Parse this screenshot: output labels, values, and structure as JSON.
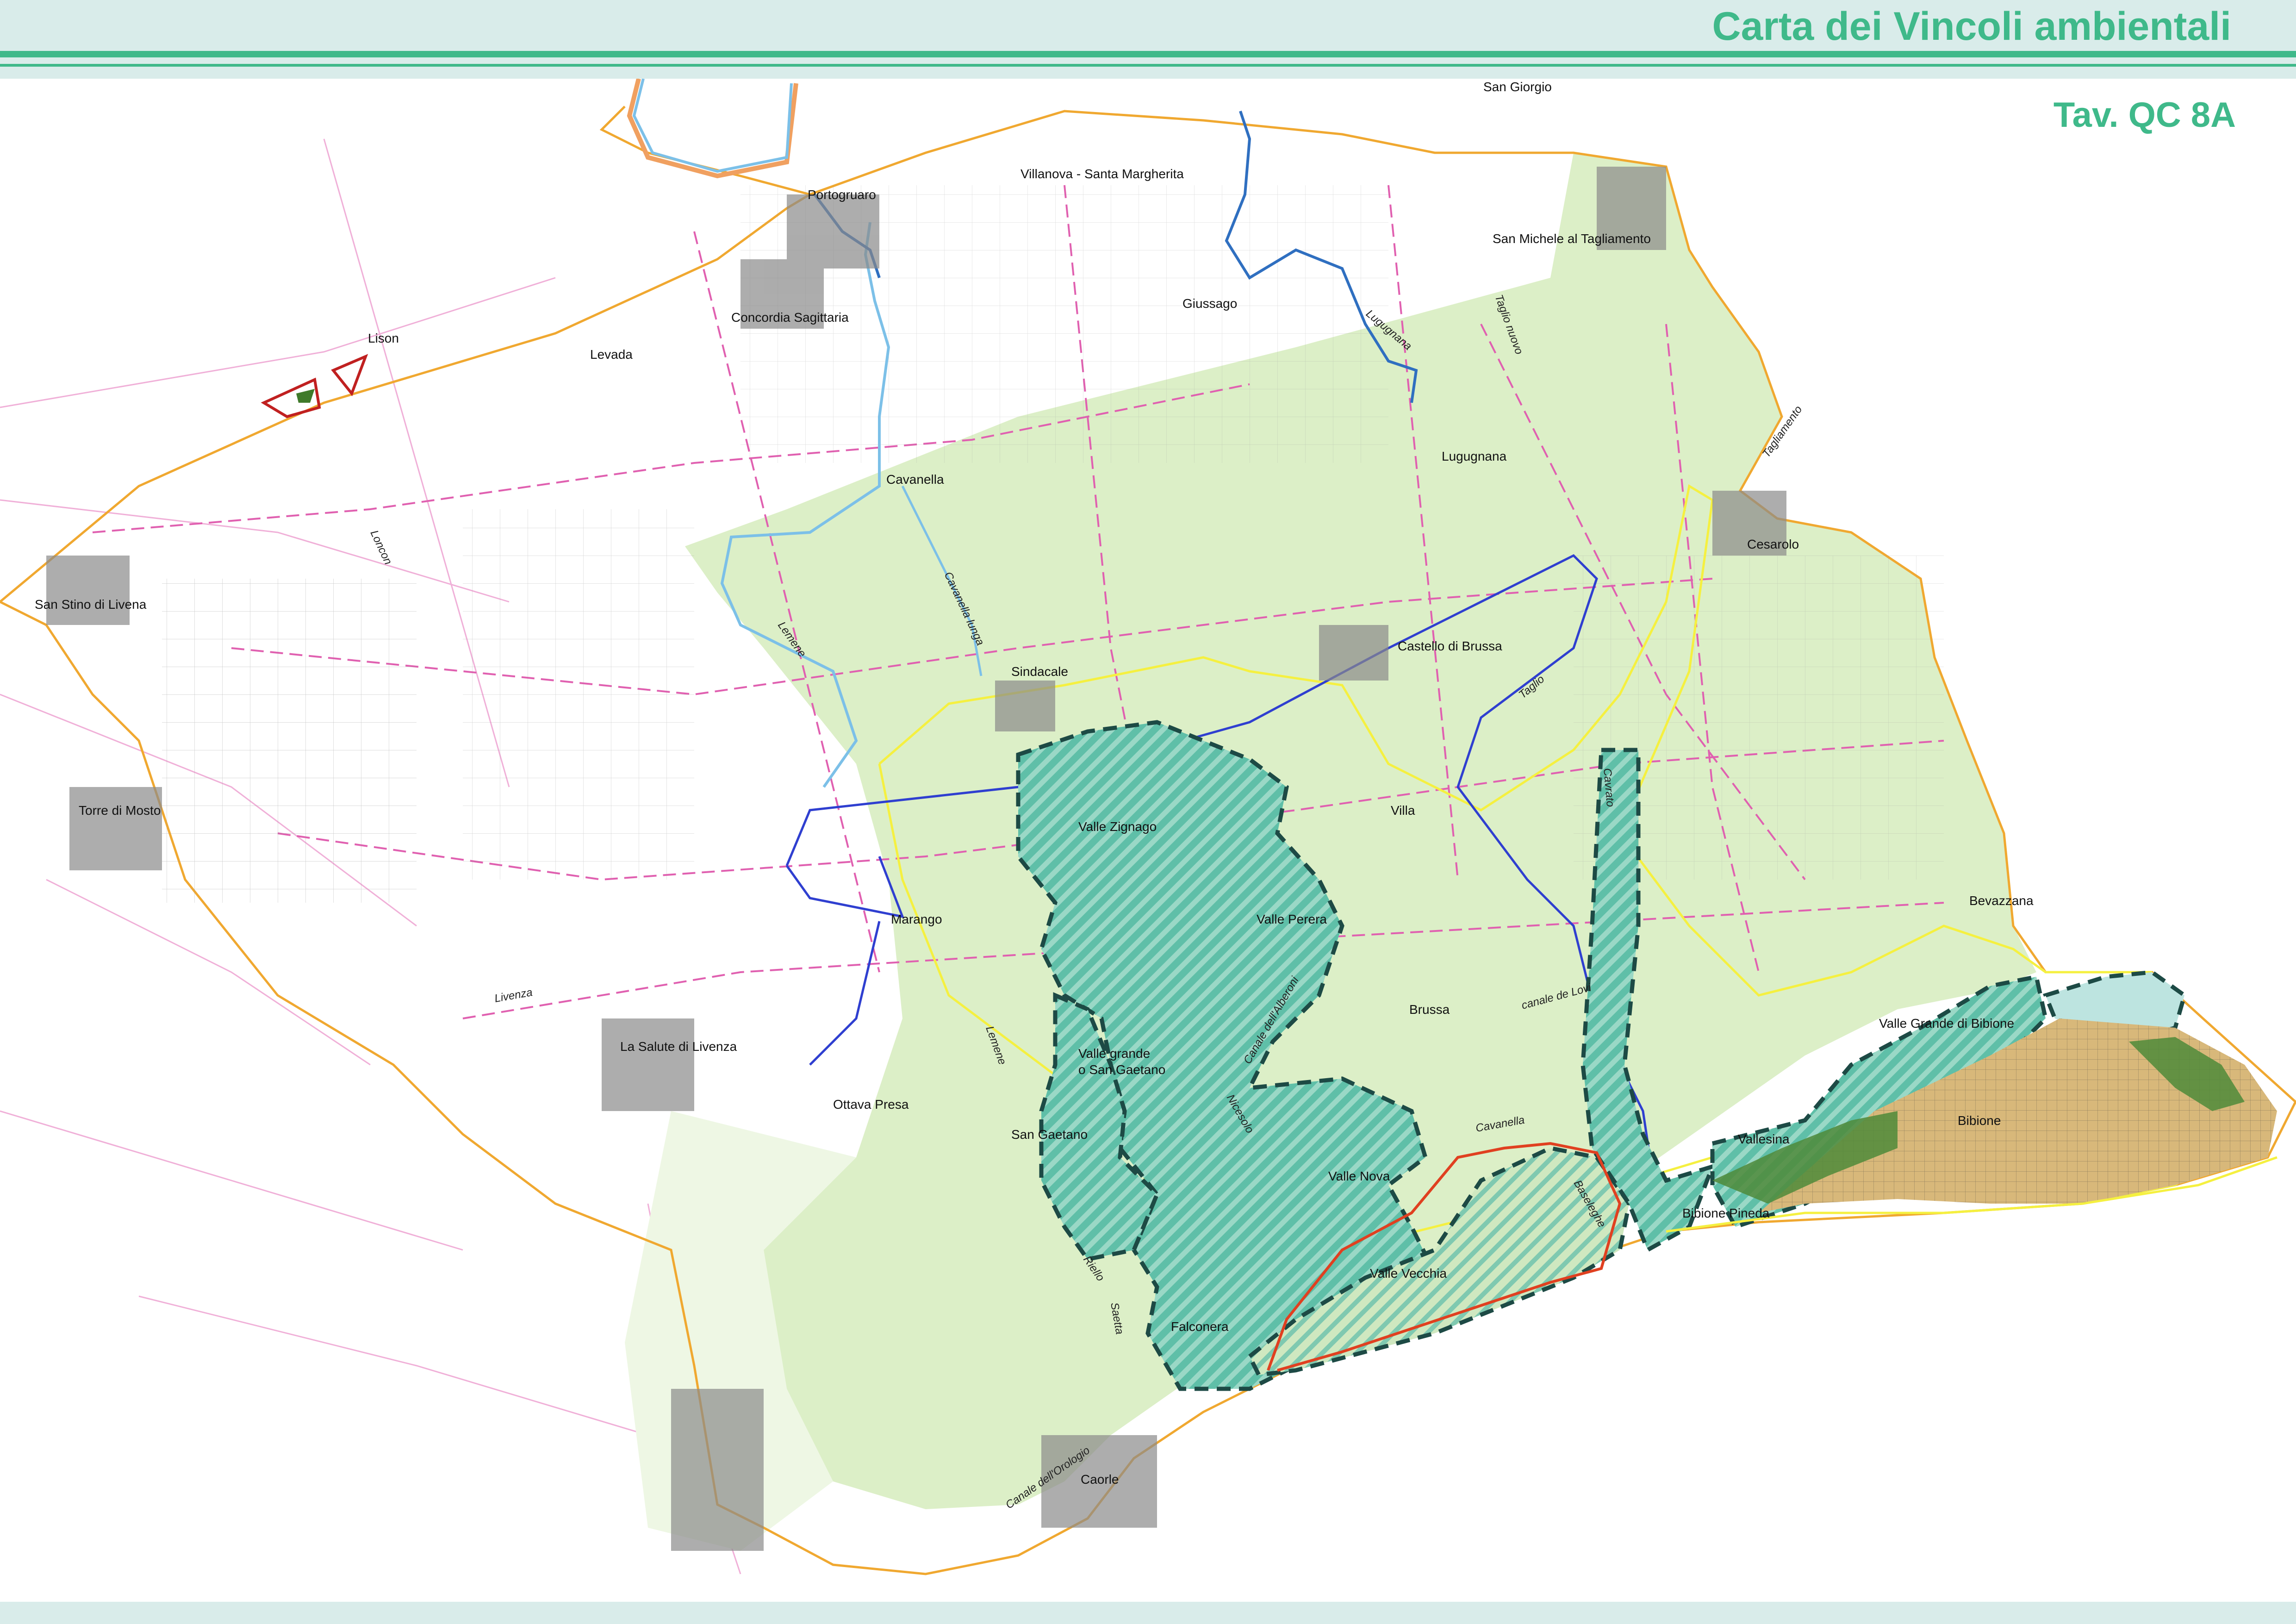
{
  "header": {
    "title": "Carta dei Vincoli ambientali",
    "sheet": "Tav. QC 8A"
  },
  "colors": {
    "accent": "#3fb98a",
    "header_band": "#d9ecea",
    "area_light": "#dcefc7",
    "area_faint": "#eaf5e0",
    "wetland": "#5fbfa8",
    "wetland_hatch": "#8fd3c2",
    "municipal_border": "#f0a830",
    "road": "#e060b0",
    "river_light": "#7cc0e8",
    "river_dark": "#2f6fc0",
    "canal_blue": "#2f3fd0",
    "yellow_line": "#f5f040",
    "red_line": "#e04020",
    "dark_dash": "#1d4a45",
    "urban_sand": "#d8b87a",
    "pine_forest": "#4f8a3a"
  },
  "places": [
    "San Giorgio",
    "Portogruaro",
    "Villanova - Santa Margherita",
    "San Michele al Tagliamento",
    "Concordia Sagittaria",
    "Giussago",
    "Lison",
    "Levada",
    "Lugugnana",
    "Cavanella",
    "Cesarolo",
    "San Stino di Livena",
    "Castello di Brussa",
    "Sindacale",
    "Villa",
    "Torre di Mosto",
    "Valle Zignago",
    "Bevazzana",
    "Valle Perera",
    "Marango",
    "Valle Grande di Bibione",
    "Brussa",
    "Valle grande",
    "o San Gaetano",
    "La Salute di Livenza",
    "Ottava Presa",
    "San Gaetano",
    "Bibione",
    "Vallesina",
    "Valle Nova",
    "Bibione Pineda",
    "Valle Vecchia",
    "Falconera",
    "Caorle"
  ],
  "waterways": [
    "Lugugnana",
    "Taglio nuovo",
    "Tagliamento",
    "Loncon",
    "Cavanella lunga",
    "Lemene",
    "Taglio",
    "Cavrato",
    "Livenza",
    "Canale dell'Alberoni",
    "canale de Lovi",
    "Lemene",
    "Nicesolo",
    "Cavanella",
    "Baseleghe",
    "Riello",
    "Saetta",
    "Canale dell'Orologio"
  ]
}
